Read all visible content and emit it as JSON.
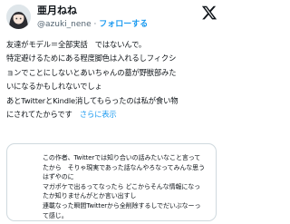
{
  "header": {
    "display_name": "亜月ねね",
    "handle": "@azuki_nene",
    "separator": "·",
    "follow_label": "フォローする"
  },
  "tweet": {
    "lines": [
      "友達がモデル＝全部実話　ではないんで。",
      "特定避けるためにある程度脚色は入れるしフィクシ",
      "ョンでことにしないとあいちゃんの墓が野獣部みた",
      "いになるかもしれないでしょ",
      "あとTwitterとKindle消してもらったのは私が食い物",
      "にされてたからです"
    ],
    "show_more_label": "さらに表示"
  },
  "quote": {
    "lines": [
      "この作者、Twitterでは知り合いの話みたいなこと言って",
      "たから　そりゃ現実であった話なんやろなってみんな思う",
      "はずやのに",
      "マガポケで出るってなったら どこからそんな情報になっ",
      "たか知りませんがとか言い出すし",
      "連載なった瞬間Twitterから全削除するしでだいぶなーっ",
      "て感じ。"
    ]
  }
}
